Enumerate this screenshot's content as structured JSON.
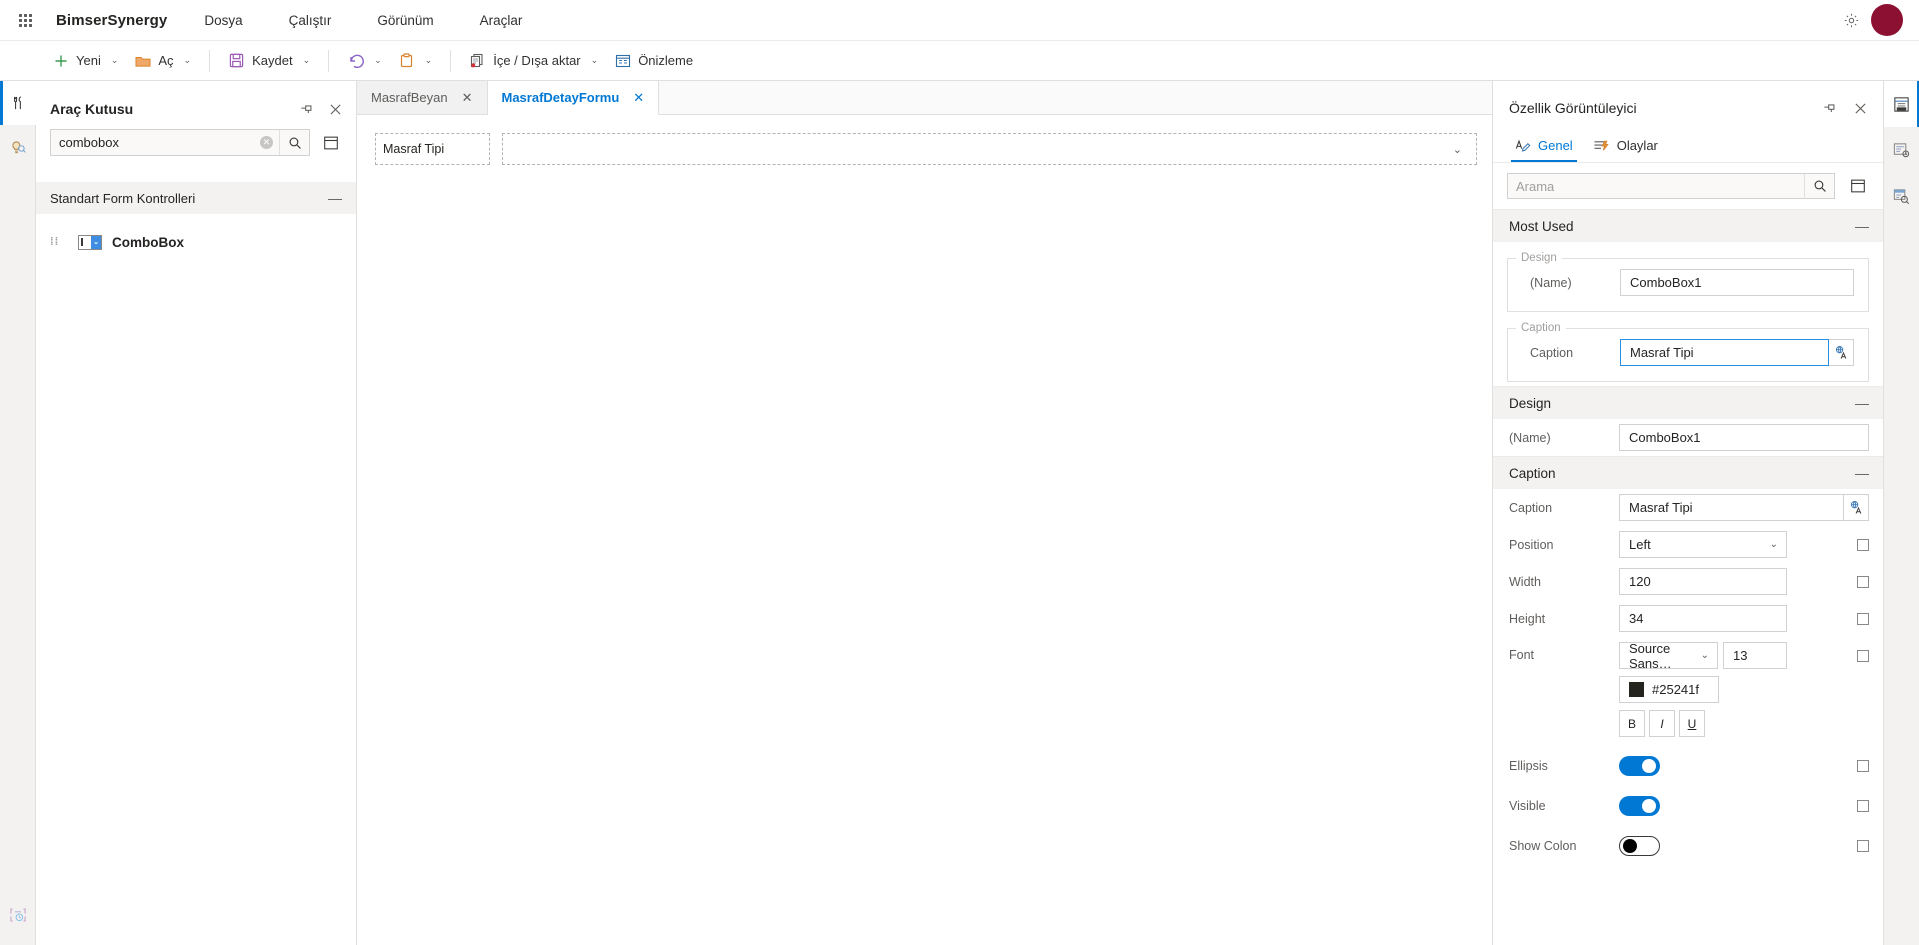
{
  "topbar": {
    "waffle_label": "app-launcher",
    "brand": "BimserSynergy",
    "menu": [
      {
        "label": "Dosya"
      },
      {
        "label": "Çalıştır"
      },
      {
        "label": "Görünüm"
      },
      {
        "label": "Araçlar"
      }
    ],
    "settings_icon": "gear-icon",
    "avatar_color": "#8c1032"
  },
  "ribbon": {
    "items": [
      {
        "label": "Yeni",
        "icon": "plus-icon",
        "caret": "⌄"
      },
      {
        "label": "Aç",
        "icon": "folder-icon",
        "caret": "⌄"
      },
      {
        "label": "Kaydet",
        "icon": "save-floppy-icon",
        "caret": "⌄"
      },
      {
        "label": "",
        "icon": "undo-icon",
        "caret": "⌄"
      },
      {
        "label": "",
        "icon": "clipboard-icon",
        "caret": "⌄"
      },
      {
        "label": "İçe / Dışa aktar",
        "icon": "import-export-icon",
        "caret": "⌄"
      },
      {
        "label": "Önizleme",
        "icon": "preview-icon",
        "caret": ""
      }
    ]
  },
  "leftrail": {
    "items": [
      {
        "name": "toolbox-rail-icon",
        "active": true
      },
      {
        "name": "inspect-lightbulb-rail-icon",
        "active": false
      }
    ],
    "bottom": {
      "name": "debug-rail-icon"
    }
  },
  "toolbox": {
    "title": "Araç Kutusu",
    "pin_icon": "pin-icon",
    "close_icon": "close-icon",
    "search": {
      "value": "combobox",
      "placeholder": "",
      "clear_icon": "clear-circle-icon",
      "search_icon": "search-icon"
    },
    "list_toggle_icon": "list-view-icon",
    "group": {
      "label": "Standart Form Kontrolleri",
      "collapse": "—"
    },
    "items": [
      {
        "label": "ComboBox",
        "icon": "combobox-icon",
        "grip": "⠿"
      }
    ]
  },
  "canvas": {
    "tabs": [
      {
        "label": "MasrafBeyan",
        "active": false,
        "close": "✕"
      },
      {
        "label": "MasrafDetayFormu",
        "active": true,
        "close": "✕"
      }
    ],
    "form": {
      "label_text": "Masraf Tipi",
      "combo_chevron": "⌄"
    }
  },
  "properties": {
    "title": "Özellik Görüntüleyici",
    "pin_icon": "pin-icon",
    "close_icon": "close-icon",
    "tabs": [
      {
        "label": "Genel",
        "icon": "properties-pencil-icon",
        "active": true
      },
      {
        "label": "Olaylar",
        "icon": "events-lightning-icon",
        "active": false
      }
    ],
    "search": {
      "placeholder": "Arama",
      "value": "",
      "search_icon": "search-icon"
    },
    "categorize_icon": "categorize-icon",
    "sections": [
      {
        "title": "Most Used",
        "collapse": "—",
        "groups": [
          {
            "legend": "Design",
            "rows": [
              {
                "label": "(Name)",
                "type": "text",
                "value": "ComboBox1",
                "focused": false
              }
            ]
          },
          {
            "legend": "Caption",
            "rows": [
              {
                "label": "Caption",
                "type": "text-lang",
                "value": "Masraf Tipi",
                "focused": true,
                "lang_icon": "translate-icon"
              }
            ]
          }
        ]
      },
      {
        "title": "Design",
        "collapse": "—",
        "rows": [
          {
            "label": "(Name)",
            "type": "text",
            "value": "ComboBox1",
            "focused": false
          }
        ]
      },
      {
        "title": "Caption",
        "collapse": "—",
        "rows": [
          {
            "label": "Caption",
            "type": "text-lang",
            "value": "Masraf Tipi",
            "focused": false,
            "lang_icon": "translate-icon"
          },
          {
            "label": "Position",
            "type": "select",
            "value": "Left",
            "chevron": "⌄",
            "checkbox": true
          },
          {
            "label": "Width",
            "type": "text",
            "value": "120",
            "checkbox": true
          },
          {
            "label": "Height",
            "type": "text",
            "value": "34",
            "checkbox": true
          },
          {
            "label": "Font",
            "type": "font",
            "family": "Source Sans…",
            "chevron": "⌄",
            "size": "13",
            "color_hex": "#25241f",
            "checkbox": true,
            "bold": "B",
            "italic": "I",
            "underline": "U"
          },
          {
            "label": "Ellipsis",
            "type": "toggle",
            "on": true,
            "checkbox": true
          },
          {
            "label": "Visible",
            "type": "toggle",
            "on": true,
            "checkbox": true
          },
          {
            "label": "Show Colon",
            "type": "toggle",
            "on": false,
            "checkbox": true
          }
        ]
      }
    ]
  },
  "rightrail": {
    "items": [
      {
        "name": "properties-viewer-rail-icon",
        "active": true
      },
      {
        "name": "settings-grid-rail-icon",
        "active": false
      },
      {
        "name": "search-grid-rail-icon",
        "active": false
      }
    ]
  }
}
